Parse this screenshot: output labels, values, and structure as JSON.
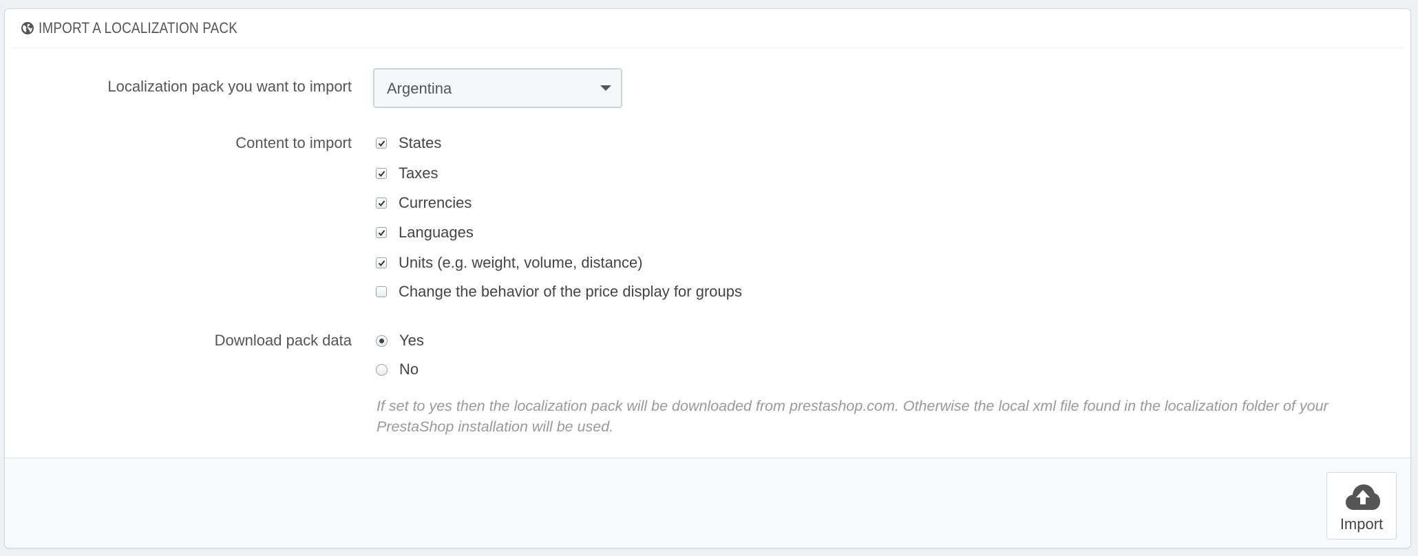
{
  "panel": {
    "title": "IMPORT A LOCALIZATION PACK",
    "icon": "globe-icon"
  },
  "form": {
    "pack_label": "Localization pack you want to import",
    "pack_selected": "Argentina",
    "content_label": "Content to import",
    "content_options": [
      {
        "label": "States",
        "checked": true
      },
      {
        "label": "Taxes",
        "checked": true
      },
      {
        "label": "Currencies",
        "checked": true
      },
      {
        "label": "Languages",
        "checked": true
      },
      {
        "label": "Units (e.g. weight, volume, distance)",
        "checked": true
      },
      {
        "label": "Change the behavior of the price display for groups",
        "checked": false
      }
    ],
    "download_label": "Download pack data",
    "download_options": [
      {
        "label": "Yes",
        "selected": true
      },
      {
        "label": "No",
        "selected": false
      }
    ],
    "help_text": "If set to yes then the localization pack will be downloaded from prestashop.com. Otherwise the local xml file found in the localization folder of your PrestaShop installation will be used."
  },
  "footer": {
    "import_label": "Import",
    "import_icon": "cloud-upload-icon"
  },
  "colors": {
    "page_bg": "#eff1f2",
    "footer_bg": "#f8fafc",
    "select_bg": "#f5f8f9",
    "select_border": "#c7d6db",
    "help_text": "#999999"
  }
}
